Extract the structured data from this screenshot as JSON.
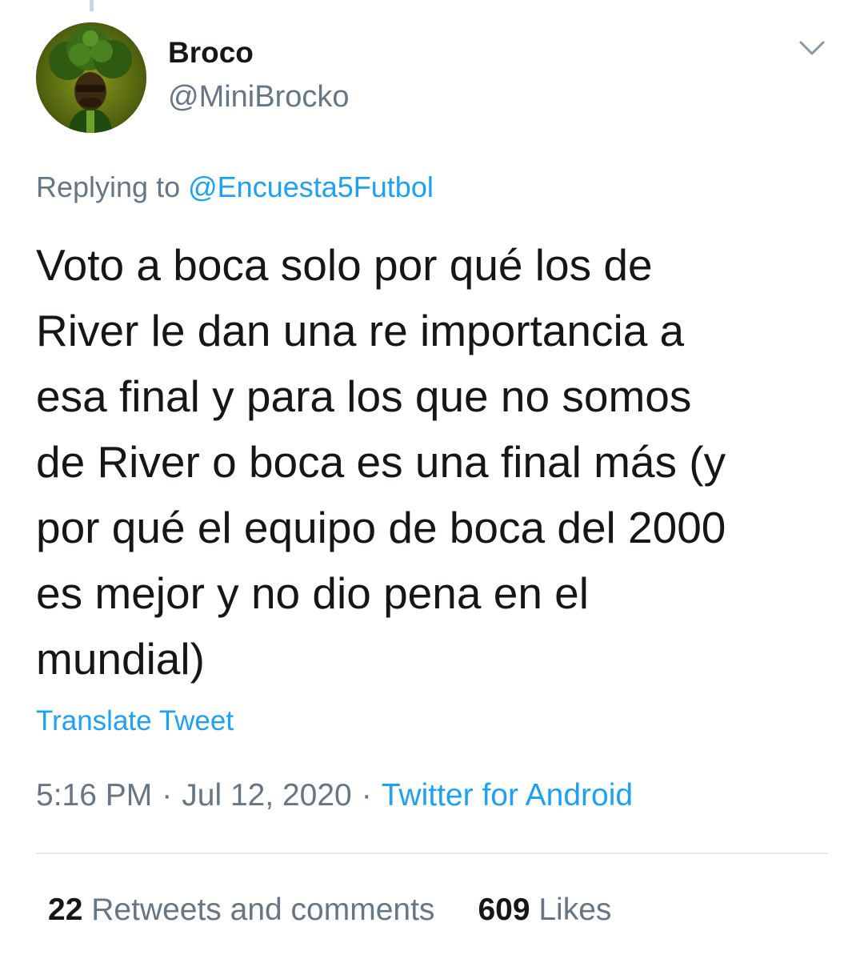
{
  "author": {
    "display_name": "Broco",
    "handle": "@MiniBrocko",
    "avatar_icon": "broccoli-afro-character-avatar"
  },
  "reply": {
    "prefix": "Replying to",
    "mention": "@Encuesta5Futbol"
  },
  "tweet": {
    "lines": [
      "Voto a boca solo por qué los de",
      "River le dan una re importancia a",
      "esa final y para los que no somos",
      "de River o boca es una final más (y",
      "por qué el equipo de boca del 2000",
      "es mejor y no dio pena en el",
      "mundial)"
    ],
    "translate_label": "Translate Tweet"
  },
  "meta": {
    "time": "5:16 PM",
    "separator": "·",
    "date": "Jul 12, 2020",
    "source": "Twitter for Android"
  },
  "stats": {
    "retweets_count": "22",
    "retweets_label": "Retweets and comments",
    "likes_count": "609",
    "likes_label": "Likes"
  },
  "menu": {
    "icon": "chevron-down-icon"
  },
  "colors": {
    "link_blue": "#1da1f2",
    "secondary_gray": "#657786",
    "text_dark": "#14171a",
    "divider": "#e6ecf0"
  }
}
